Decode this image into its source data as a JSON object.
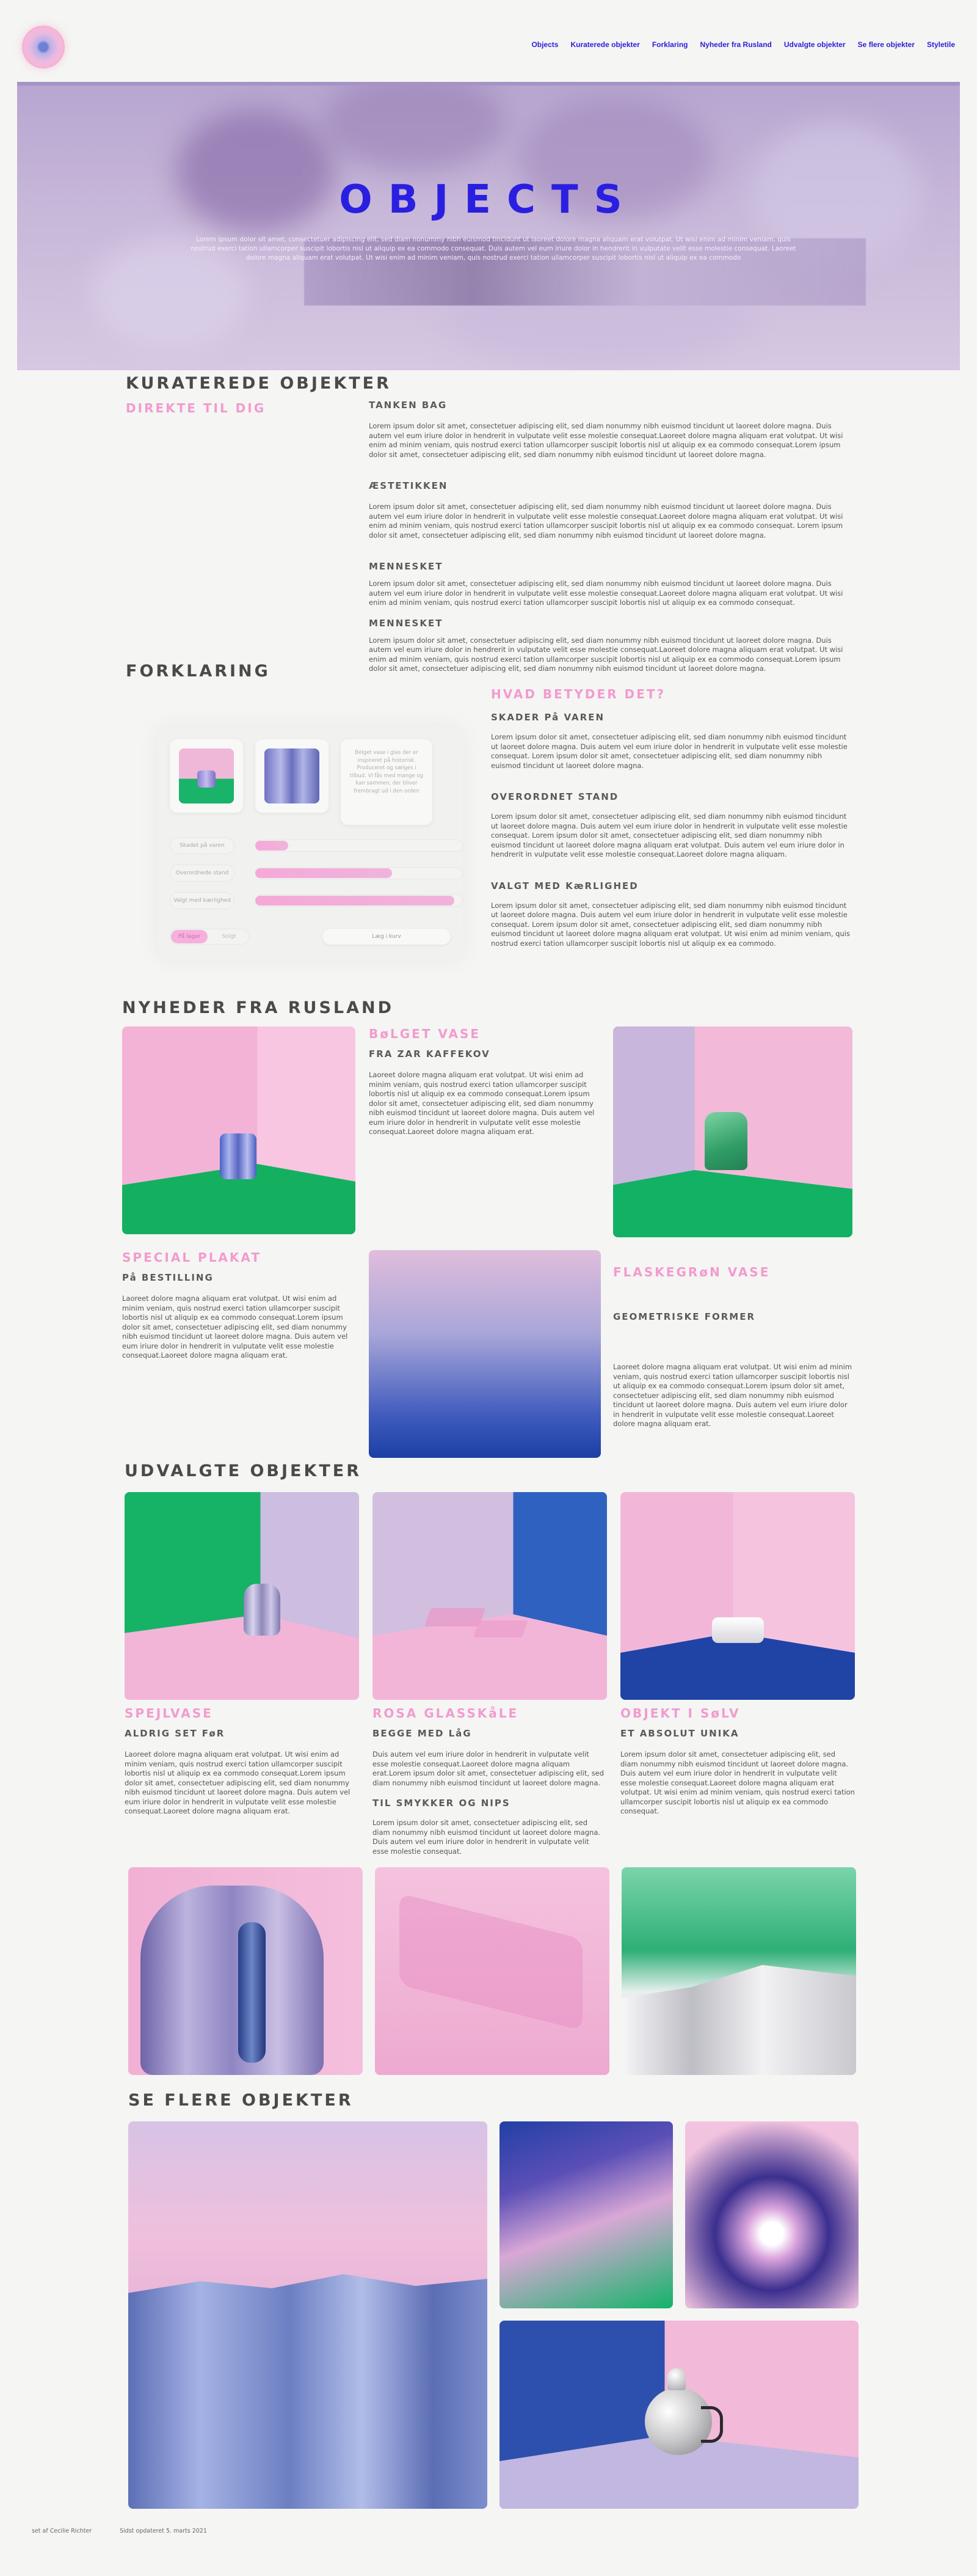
{
  "nav": {
    "items": [
      "Objects",
      "Kuraterede objekter",
      "Forklaring",
      "Nyheder fra Rusland",
      "Udvalgte objekter",
      "Se flere objekter",
      "Styletile"
    ]
  },
  "hero": {
    "title": "OBJECTS",
    "text": "Lorem ipsum dolor sit amet, consectetuer adipiscing elit, sed diam nonummy nibh euismod tincidunt ut laoreet dolore magna aliquam erat volutpat. Ut wisi enim ad minim veniam, quis nostrud exerci tation ullamcorper suscipit lobortis nisl ut aliquip ex ea commodo consequat. Duis autem vel eum iriure dolor in hendrerit in vulputate velit esse molestie consequat. Laoreet dolore magna aliquam erat volutpat. Ut wisi enim ad minim veniam, quis nostrud exerci tation ullamcorper suscipit lobortis nisl ut aliquip ex ea commodo"
  },
  "curated": {
    "title": "KURATEREDE OBJEKTER",
    "subtitle": "DIREKTE TIL DIG",
    "blocks": [
      {
        "heading": "TANKEN BAG",
        "text": "Lorem ipsum dolor sit amet, consectetuer adipiscing elit, sed diam nonummy nibh euismod tincidunt ut laoreet dolore magna. Duis autem vel eum iriure dolor in hendrerit in vulputate velit esse molestie consequat.Laoreet dolore magna aliquam erat volutpat. Ut wisi enim ad minim veniam, quis nostrud exerci tation ullamcorper suscipit lobortis nisl ut aliquip ex ea commodo consequat.Lorem ipsum dolor sit amet, consectetuer adipiscing elit, sed diam nonummy nibh euismod tincidunt ut laoreet dolore magna."
      },
      {
        "heading": "ÆSTETIKKEN",
        "text": "Lorem ipsum dolor sit amet, consectetuer adipiscing elit, sed diam nonummy nibh euismod tincidunt ut laoreet dolore magna. Duis autem vel eum iriure dolor in hendrerit in vulputate velit esse molestie consequat.Laoreet dolore magna aliquam erat volutpat. Ut wisi enim ad minim veniam, quis nostrud exerci tation ullamcorper suscipit lobortis nisl ut aliquip ex ea commodo consequat. Lorem ipsum dolor sit amet, consectetuer adipiscing elit, sed diam nonummy nibh euismod tincidunt ut laoreet dolore magna."
      },
      {
        "heading": "MENNESKET",
        "text": "Lorem ipsum dolor sit amet, consectetuer adipiscing elit, sed diam nonummy nibh euismod tincidunt ut laoreet dolore magna. Duis autem vel eum iriure dolor in hendrerit in vulputate velit esse molestie consequat.Laoreet dolore magna aliquam erat volutpat. Ut wisi enim ad minim veniam, quis nostrud exerci tation ullamcorper suscipit lobortis nisl ut aliquip ex ea commodo consequat."
      },
      {
        "heading": "MENNESKET",
        "text": "Lorem ipsum dolor sit amet, consectetuer adipiscing elit, sed diam nonummy nibh euismod tincidunt ut laoreet dolore magna. Duis autem vel eum iriure dolor in hendrerit in vulputate velit esse molestie consequat.Laoreet dolore magna aliquam erat volutpat. Ut wisi enim ad minim veniam, quis nostrud exerci tation ullamcorper suscipit lobortis nisl ut aliquip ex ea commodo consequat.Lorem ipsum dolor sit amet, consectetuer adipiscing elit, sed diam nonummy nibh euismod tincidunt ut laoreet dolore magna."
      }
    ]
  },
  "explain": {
    "title": "FORKLARING",
    "subtitle": "HVAD BETYDER DET?",
    "mock": {
      "note": "Belget vase i glas der er inspireret på historisk. Produceret og sælges i tilbud. Vi fås med mange og kan sammen, der bliver frembragt ud i den orden",
      "rows": [
        {
          "label": "Skadet på varen",
          "level": 0.16
        },
        {
          "label": "Overordnede stand",
          "level": 0.66
        },
        {
          "label": "Valgt med kærlighed",
          "level": 0.96
        }
      ],
      "toggle": [
        "På lager",
        "Solgt"
      ],
      "button": "Læg i kurv"
    },
    "blocks": [
      {
        "heading": "SKADER På VAREN",
        "text": "Lorem ipsum dolor sit amet, consectetuer adipiscing elit, sed diam nonummy nibh euismod tincidunt ut laoreet dolore magna. Duis autem vel eum iriure dolor in hendrerit in vulputate velit esse molestie consequat. Lorem ipsum dolor sit amet, consectetuer adipiscing elit, sed diam nonummy nibh euismod tincidunt ut laoreet dolore magna."
      },
      {
        "heading": "OVERORDNET STAND",
        "text": "Lorem ipsum dolor sit amet, consectetuer adipiscing elit, sed diam nonummy nibh euismod tincidunt ut laoreet dolore magna. Duis autem vel eum iriure dolor in hendrerit in vulputate velit esse molestie consequat. Lorem ipsum dolor sit amet, consectetuer adipiscing elit, sed diam nonummy nibh euismod tincidunt ut laoreet dolore magna aliquam erat volutpat. Duis autem vel eum iriure dolor in hendrerit in vulputate velit esse molestie consequat.Laoreet dolore magna aliquam."
      },
      {
        "heading": "VALGT MED KæRLIGHED",
        "text": "Lorem ipsum dolor sit amet, consectetuer adipiscing elit, sed diam nonummy nibh euismod tincidunt ut laoreet dolore magna. Duis autem vel eum iriure dolor in hendrerit in vulputate velit esse molestie consequat. Lorem ipsum dolor sit amet, consectetuer adipiscing elit, sed diam nonummy nibh euismod tincidunt ut laoreet dolore magna aliquam erat volutpat. Ut wisi enim ad minim veniam, quis nostrud exerci tation ullamcorper suscipit lobortis nisl ut aliquip ex ea commodo."
      }
    ]
  },
  "news": {
    "title": "NYHEDER FRA RUSLAND",
    "vase": {
      "title": "BøLGET VASE",
      "sub": "FRA ZAR KAFFEKOV",
      "text": "Laoreet dolore magna aliquam erat volutpat. Ut wisi enim ad minim veniam, quis nostrud exerci tation ullamcorper suscipit lobortis nisl ut aliquip ex ea commodo consequat.Lorem ipsum dolor sit amet, consectetuer adipiscing elit, sed diam nonummy nibh euismod tincidunt ut laoreet dolore magna. Duis autem vel eum iriure dolor in hendrerit in vulputate velit esse molestie consequat.Laoreet dolore magna aliquam erat."
    },
    "poster": {
      "title": "SPECIAL PLAKAT",
      "sub": "På BESTILLING",
      "text": "Laoreet dolore magna aliquam erat volutpat. Ut wisi enim ad minim veniam, quis nostrud exerci tation ullamcorper suscipit lobortis nisl ut aliquip ex ea commodo consequat.Lorem ipsum dolor sit amet, consectetuer adipiscing elit, sed diam nonummy nibh euismod tincidunt ut laoreet dolore magna. Duis autem vel eum iriure dolor in hendrerit in vulputate velit esse molestie consequat.Laoreet dolore magna aliquam erat."
    },
    "bottle": {
      "title": "FLASKEGRøN VASE",
      "sub": "GEOMETRISKE FORMER",
      "text": "Laoreet dolore magna aliquam erat volutpat. Ut wisi enim ad minim veniam, quis nostrud exerci tation ullamcorper suscipit lobortis nisl ut aliquip ex ea commodo consequat.Lorem ipsum dolor sit amet, consectetuer adipiscing elit, sed diam nonummy nibh euismod tincidunt ut laoreet dolore magna. Duis autem vel eum iriure dolor in hendrerit in vulputate velit esse molestie consequat.Laoreet dolore magna aliquam erat."
    }
  },
  "selected": {
    "title": "UDVALGTE OBJEKTER",
    "items": [
      {
        "title": "SPEJLVASE",
        "sub": "ALDRIG SET FøR",
        "text": "Laoreet dolore magna aliquam erat volutpat. Ut wisi enim ad minim veniam, quis nostrud exerci tation ullamcorper suscipit lobortis nisl ut aliquip ex ea commodo consequat.Lorem ipsum dolor sit amet, consectetuer adipiscing elit, sed diam nonummy nibh euismod tincidunt ut laoreet dolore magna. Duis autem vel eum iriure dolor in hendrerit in vulputate velit esse molestie consequat.Laoreet dolore magna aliquam erat."
      },
      {
        "title": "ROSA GLASSKåLE",
        "sub": "BEGGE MED LåG",
        "text": "Duis autem vel eum iriure dolor in hendrerit in vulputate velit esse molestie consequat.Laoreet dolore magna aliquam erat.Lorem ipsum dolor sit amet, consectetuer adipiscing elit, sed diam nonummy nibh euismod tincidunt ut laoreet dolore magna.",
        "sub2": "TIL SMYKKER OG NIPS",
        "text2": "Lorem ipsum dolor sit amet, consectetuer adipiscing elit, sed diam nonummy nibh euismod tincidunt ut laoreet dolore magna. Duis autem vel eum iriure dolor in hendrerit in vulputate velit esse molestie consequat."
      },
      {
        "title": "OBJEKT I SøLV",
        "sub": "ET ABSOLUT UNIKA",
        "text": "Lorem ipsum dolor sit amet, consectetuer adipiscing elit, sed diam nonummy nibh euismod tincidunt ut laoreet dolore magna. Duis autem vel eum iriure dolor in hendrerit in vulputate velit esse molestie consequat.Laoreet dolore magna aliquam erat volutpat. Ut wisi enim ad minim veniam, quis nostrud exerci tation ullamcorper suscipit lobortis nisl ut aliquip ex ea commodo consequat."
      }
    ]
  },
  "more": {
    "title": "SE FLERE OBJEKTER"
  },
  "footer": {
    "credit": "set af Cecilie Richter",
    "updated": "Sidst opdateret 5. marts 2021"
  },
  "colors": {
    "accent": "#2a1fd6",
    "pink": "#f29bcf",
    "green": "#0db36c",
    "blue": "#2a4fb0"
  }
}
